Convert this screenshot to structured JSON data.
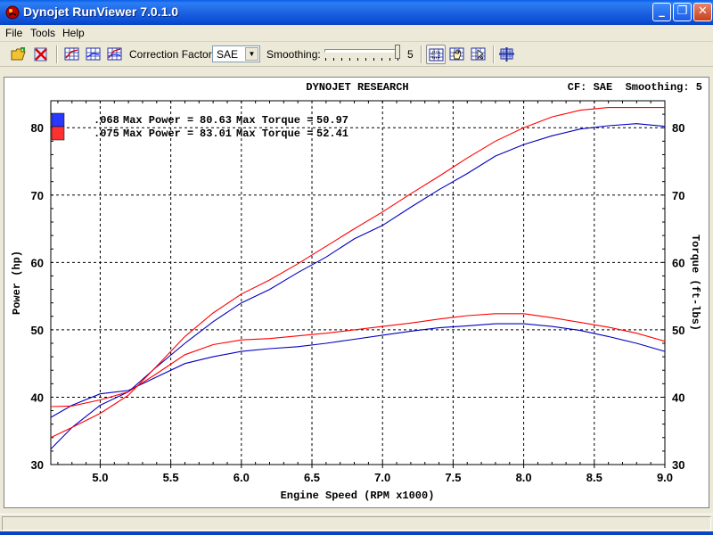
{
  "window": {
    "title": "Dynojet RunViewer 7.0.1.0",
    "minimize_glyph": "_",
    "maximize_glyph": "❐",
    "close_glyph": "✕"
  },
  "menu": [
    "File",
    "Tools",
    "Help"
  ],
  "toolbar": {
    "correction_factor_label": "Correction Factor:",
    "correction_factor_value": "SAE",
    "smoothing_label": "Smoothing:",
    "smoothing_value": "5"
  },
  "colors": {
    "run1": "#0000c0",
    "run2": "#ff0000",
    "grid": "#000000"
  },
  "chart_data": {
    "type": "line",
    "title": "DYNOJET RESEARCH",
    "header_right": "CF: SAE  Smoothing: 5",
    "xlabel": "Engine Speed (RPM x1000)",
    "ylabel_left": "Power (hp)",
    "ylabel_right": "Torque (ft-lbs)",
    "xlim": [
      4.65,
      9.0
    ],
    "ylim": [
      30,
      84
    ],
    "x_ticks": [
      "5.0",
      "5.5",
      "6.0",
      "6.5",
      "7.0",
      "7.5",
      "8.0",
      "8.5",
      "9.0"
    ],
    "y_ticks": [
      "30",
      "40",
      "50",
      "60",
      "70",
      "80"
    ],
    "grid": true,
    "legend": [
      {
        "run": ".068",
        "max_power_label": "Max Power = ",
        "max_power": "80.63",
        "max_torque_label": "Max Torque = ",
        "max_torque": "50.97",
        "color": "#0000c0"
      },
      {
        "run": ".075",
        "max_power_label": "Max Power = ",
        "max_power": "83.01",
        "max_torque_label": "Max Torque = ",
        "max_torque": "52.41",
        "color": "#ff0000"
      }
    ],
    "series": [
      {
        "run": ".068",
        "measure": "power",
        "color": "#0000c0",
        "x": [
          4.65,
          4.8,
          5.0,
          5.2,
          5.4,
          5.6,
          5.8,
          6.0,
          6.2,
          6.4,
          6.6,
          6.8,
          7.0,
          7.2,
          7.4,
          7.6,
          7.8,
          8.0,
          8.2,
          8.4,
          8.6,
          8.8,
          9.0
        ],
        "y": [
          32.3,
          35.5,
          38.8,
          40.8,
          44.5,
          48.0,
          51.2,
          54.0,
          56.0,
          58.5,
          60.8,
          63.5,
          65.5,
          68.2,
          70.8,
          73.2,
          75.8,
          77.5,
          78.8,
          79.8,
          80.3,
          80.6,
          80.2
        ]
      },
      {
        "run": ".075",
        "measure": "power",
        "color": "#ff0000",
        "x": [
          4.65,
          4.8,
          5.0,
          5.2,
          5.4,
          5.6,
          5.8,
          6.0,
          6.2,
          6.4,
          6.6,
          6.8,
          7.0,
          7.2,
          7.4,
          7.6,
          7.8,
          8.0,
          8.2,
          8.4,
          8.6,
          8.8,
          9.0
        ],
        "y": [
          34.0,
          35.5,
          37.6,
          40.3,
          44.6,
          49.0,
          52.5,
          55.3,
          57.4,
          59.8,
          62.4,
          65.0,
          67.5,
          70.2,
          72.8,
          75.5,
          78.0,
          80.0,
          81.6,
          82.6,
          83.0,
          83.0,
          83.0
        ]
      },
      {
        "run": ".068",
        "measure": "torque",
        "color": "#0000c0",
        "x": [
          4.65,
          4.8,
          5.0,
          5.2,
          5.4,
          5.6,
          5.8,
          6.0,
          6.2,
          6.4,
          6.6,
          6.8,
          7.0,
          7.2,
          7.4,
          7.6,
          7.8,
          8.0,
          8.2,
          8.4,
          8.6,
          8.8,
          9.0
        ],
        "y": [
          37.0,
          38.8,
          40.5,
          41.0,
          43.0,
          45.0,
          46.0,
          46.8,
          47.2,
          47.5,
          48.0,
          48.6,
          49.2,
          49.8,
          50.3,
          50.6,
          50.9,
          50.9,
          50.5,
          49.9,
          49.0,
          48.0,
          46.8
        ]
      },
      {
        "run": ".075",
        "measure": "torque",
        "color": "#ff0000",
        "x": [
          4.65,
          4.8,
          5.0,
          5.2,
          5.4,
          5.6,
          5.8,
          6.0,
          6.2,
          6.4,
          6.6,
          6.8,
          7.0,
          7.2,
          7.4,
          7.6,
          7.8,
          8.0,
          8.2,
          8.4,
          8.6,
          8.8,
          9.0
        ],
        "y": [
          38.6,
          38.7,
          39.6,
          40.8,
          43.5,
          46.3,
          47.8,
          48.5,
          48.7,
          49.1,
          49.5,
          50.0,
          50.5,
          51.0,
          51.6,
          52.1,
          52.4,
          52.4,
          51.8,
          51.1,
          50.4,
          49.5,
          48.3
        ]
      }
    ]
  }
}
